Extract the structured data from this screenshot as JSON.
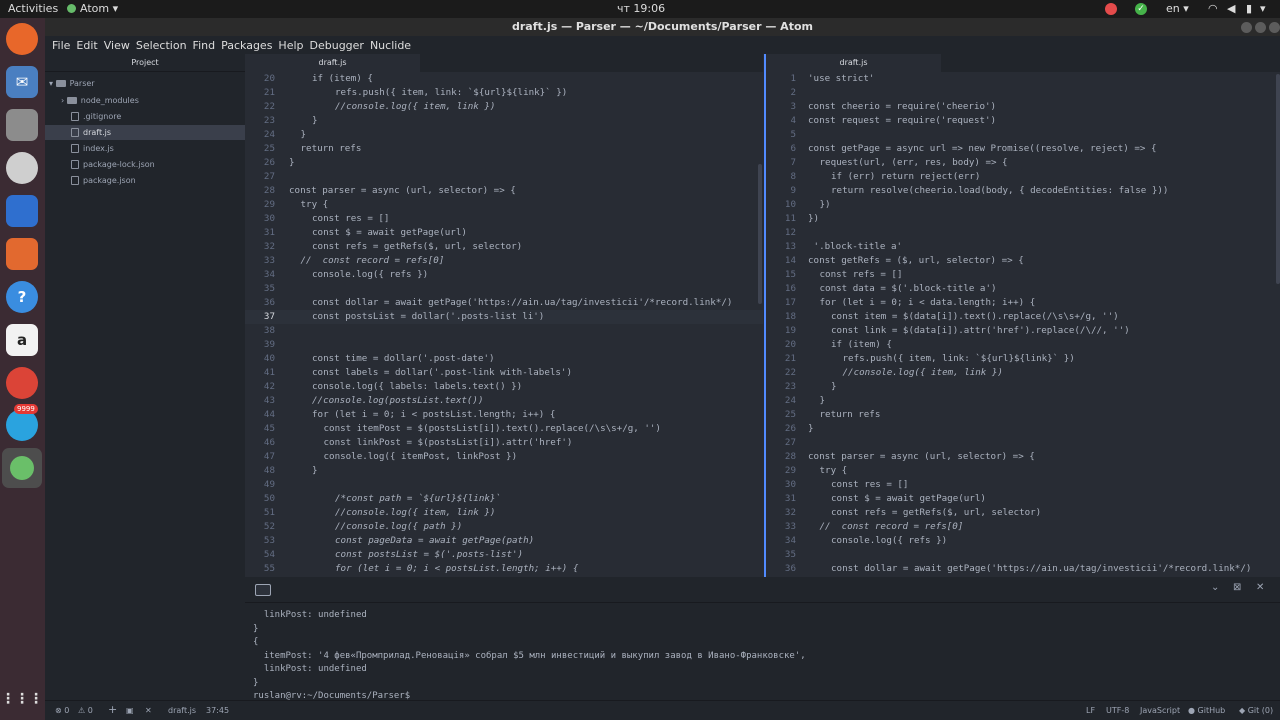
{
  "system": {
    "activities": "Activities",
    "app_name": "Atom",
    "clock": "чт 19:06",
    "lang": "en",
    "badge": "9999"
  },
  "window": {
    "title": "draft.js — Parser — ~/Documents/Parser — Atom"
  },
  "menu": [
    "File",
    "Edit",
    "View",
    "Selection",
    "Find",
    "Packages",
    "Help",
    "Debugger",
    "Nuclide"
  ],
  "tree": {
    "header": "Project",
    "root": "Parser",
    "items": [
      {
        "label": "node_modules",
        "type": "folder"
      },
      {
        "label": ".gitignore",
        "type": "file"
      },
      {
        "label": "draft.js",
        "type": "file",
        "selected": true
      },
      {
        "label": "index.js",
        "type": "file"
      },
      {
        "label": "package-lock.json",
        "type": "file"
      },
      {
        "label": "package.json",
        "type": "file"
      }
    ]
  },
  "left_pane": {
    "tab": "draft.js",
    "cursor_line": 37,
    "lines": [
      {
        "n": "20",
        "i": 2,
        "t": "if (item) {"
      },
      {
        "n": "21",
        "i": 4,
        "t": "refs.push({ item, link: `${url}${link}` })"
      },
      {
        "n": "22",
        "i": 4,
        "t": "//console.log({ item, link })",
        "c": true
      },
      {
        "n": "23",
        "i": 2,
        "t": "}"
      },
      {
        "n": "24",
        "i": 1,
        "t": "}"
      },
      {
        "n": "25",
        "i": 1,
        "t": "return refs"
      },
      {
        "n": "26",
        "i": 0,
        "t": "}"
      },
      {
        "n": "27",
        "i": 0,
        "t": ""
      },
      {
        "n": "28",
        "i": 0,
        "t": "const parser = async (url, selector) => {"
      },
      {
        "n": "29",
        "i": 1,
        "t": "try {"
      },
      {
        "n": "30",
        "i": 2,
        "t": "const res = []"
      },
      {
        "n": "31",
        "i": 2,
        "t": "const $ = await getPage(url)"
      },
      {
        "n": "32",
        "i": 2,
        "t": "const refs = getRefs($, url, selector)"
      },
      {
        "n": "33",
        "i": 1,
        "t": "//  const record = refs[0]",
        "c": true
      },
      {
        "n": "34",
        "i": 2,
        "t": "console.log({ refs })"
      },
      {
        "n": "35",
        "i": 0,
        "t": ""
      },
      {
        "n": "36",
        "i": 2,
        "t": "const dollar = await getPage('https://ain.ua/tag/investicii'/*record.link*/)"
      },
      {
        "n": "37",
        "i": 2,
        "t": "const postsList = dollar('.posts-list li')"
      },
      {
        "n": "38",
        "i": 0,
        "t": ""
      },
      {
        "n": "39",
        "i": 0,
        "t": ""
      },
      {
        "n": "40",
        "i": 2,
        "t": "const time = dollar('.post-date')"
      },
      {
        "n": "41",
        "i": 2,
        "t": "const labels = dollar('.post-link with-labels')"
      },
      {
        "n": "42",
        "i": 2,
        "t": "console.log({ labels: labels.text() })"
      },
      {
        "n": "43",
        "i": 2,
        "t": "//console.log(postsList.text())",
        "c": true
      },
      {
        "n": "44",
        "i": 2,
        "t": "for (let i = 0; i < postsList.length; i++) {"
      },
      {
        "n": "45",
        "i": 3,
        "t": "const itemPost = $(postsList[i]).text().replace(/\\s\\s+/g, '')"
      },
      {
        "n": "46",
        "i": 3,
        "t": "const linkPost = $(postsList[i]).attr('href')"
      },
      {
        "n": "47",
        "i": 3,
        "t": "console.log({ itemPost, linkPost })"
      },
      {
        "n": "48",
        "i": 2,
        "t": "}"
      },
      {
        "n": "49",
        "i": 0,
        "t": ""
      },
      {
        "n": "50",
        "i": 4,
        "t": "/*const path = `${url}${link}`",
        "c": true
      },
      {
        "n": "51",
        "i": 4,
        "t": "//console.log({ item, link })",
        "c": true
      },
      {
        "n": "52",
        "i": 4,
        "t": "//console.log({ path })",
        "c": true
      },
      {
        "n": "53",
        "i": 4,
        "t": "const pageData = await getPage(path)",
        "c": true
      },
      {
        "n": "54",
        "i": 4,
        "t": "const postsList = $('.posts-list')",
        "c": true
      },
      {
        "n": "55",
        "i": 4,
        "t": "for (let i = 0; i < postsList.length; i++) {",
        "c": true
      }
    ]
  },
  "right_pane": {
    "tab": "draft.js",
    "lines": [
      {
        "n": "1",
        "i": 0,
        "t": "'use strict'"
      },
      {
        "n": "2",
        "i": 0,
        "t": ""
      },
      {
        "n": "3",
        "i": 0,
        "t": "const cheerio = require('cheerio')"
      },
      {
        "n": "4",
        "i": 0,
        "t": "const request = require('request')"
      },
      {
        "n": "5",
        "i": 0,
        "t": ""
      },
      {
        "n": "6",
        "i": 0,
        "t": "const getPage = async url => new Promise((resolve, reject) => {"
      },
      {
        "n": "7",
        "i": 1,
        "t": "request(url, (err, res, body) => {"
      },
      {
        "n": "8",
        "i": 2,
        "t": "if (err) return reject(err)"
      },
      {
        "n": "9",
        "i": 2,
        "t": "return resolve(cheerio.load(body, { decodeEntities: false }))"
      },
      {
        "n": "10",
        "i": 1,
        "t": "})"
      },
      {
        "n": "11",
        "i": 0,
        "t": "})"
      },
      {
        "n": "12",
        "i": 0,
        "t": ""
      },
      {
        "n": "13",
        "i": 0,
        "t": " '.block-title a'"
      },
      {
        "n": "14",
        "i": 0,
        "t": "const getRefs = ($, url, selector) => {"
      },
      {
        "n": "15",
        "i": 1,
        "t": "const refs = []"
      },
      {
        "n": "16",
        "i": 1,
        "t": "const data = $('.block-title a')"
      },
      {
        "n": "17",
        "i": 1,
        "t": "for (let i = 0; i < data.length; i++) {"
      },
      {
        "n": "18",
        "i": 2,
        "t": "const item = $(data[i]).text().replace(/\\s\\s+/g, '')"
      },
      {
        "n": "19",
        "i": 2,
        "t": "const link = $(data[i]).attr('href').replace(/\\//, '')"
      },
      {
        "n": "20",
        "i": 2,
        "t": "if (item) {"
      },
      {
        "n": "21",
        "i": 3,
        "t": "refs.push({ item, link: `${url}${link}` })"
      },
      {
        "n": "22",
        "i": 3,
        "t": "//console.log({ item, link })",
        "c": true
      },
      {
        "n": "23",
        "i": 2,
        "t": "}"
      },
      {
        "n": "24",
        "i": 1,
        "t": "}"
      },
      {
        "n": "25",
        "i": 1,
        "t": "return refs"
      },
      {
        "n": "26",
        "i": 0,
        "t": "}"
      },
      {
        "n": "27",
        "i": 0,
        "t": ""
      },
      {
        "n": "28",
        "i": 0,
        "t": "const parser = async (url, selector) => {"
      },
      {
        "n": "29",
        "i": 1,
        "t": "try {"
      },
      {
        "n": "30",
        "i": 2,
        "t": "const res = []"
      },
      {
        "n": "31",
        "i": 2,
        "t": "const $ = await getPage(url)"
      },
      {
        "n": "32",
        "i": 2,
        "t": "const refs = getRefs($, url, selector)"
      },
      {
        "n": "33",
        "i": 1,
        "t": "//  const record = refs[0]",
        "c": true
      },
      {
        "n": "34",
        "i": 2,
        "t": "console.log({ refs })"
      },
      {
        "n": "35",
        "i": 0,
        "t": ""
      },
      {
        "n": "36",
        "i": 2,
        "t": "const dollar = await getPage('https://ain.ua/tag/investicii'/*record.link*/)"
      }
    ]
  },
  "terminal": {
    "lines": [
      {
        "t": "  linkPost: undefined"
      },
      {
        "t": "}"
      },
      {
        "t": "{"
      },
      {
        "t": "  itemPost: '4 фев«Промприлад.Реновація» собрал $5 млн инвестиций и выкупил завод в Ивано-Франковске',"
      },
      {
        "t": "  linkPost: undefined"
      },
      {
        "t": "}"
      },
      {
        "t": "ruslan@rv:~/Documents/Parser$"
      }
    ]
  },
  "statusbar": {
    "errors": "0",
    "warnings": "0",
    "file": "draft.js",
    "position": "37:45",
    "eol": "LF",
    "encoding": "UTF-8",
    "grammar": "JavaScript",
    "github": "GitHub",
    "git": "Git (0)"
  },
  "colors": {
    "keyword": "#c678dd",
    "string": "#98c379",
    "function": "#61afef",
    "comment": "#5c6370",
    "number": "#d19a66",
    "property": "#e06c75",
    "text": "#abb2bf",
    "accent": "#528bff"
  }
}
